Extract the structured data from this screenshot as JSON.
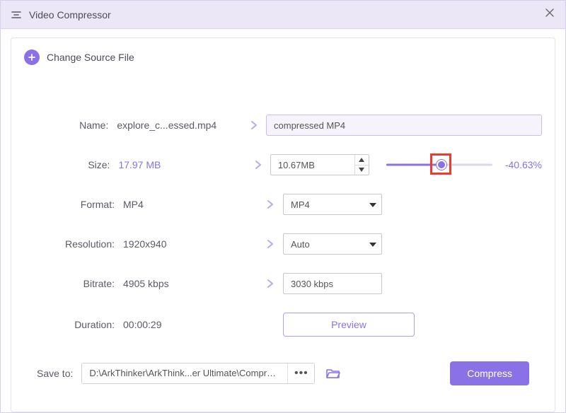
{
  "window": {
    "title": "Video Compressor"
  },
  "change_source": {
    "label": "Change Source File"
  },
  "fields": {
    "name": {
      "label": "Name:",
      "current": "explore_c...essed.mp4",
      "input": "compressed MP4"
    },
    "size": {
      "label": "Size:",
      "current": "17.97 MB",
      "input": "10.67MB",
      "delta": "-40.63%"
    },
    "format": {
      "label": "Format:",
      "current": "MP4",
      "input": "MP4"
    },
    "resolution": {
      "label": "Resolution:",
      "current": "1920x940",
      "input": "Auto"
    },
    "bitrate": {
      "label": "Bitrate:",
      "current": "4905 kbps",
      "input": "3030 kbps"
    },
    "duration": {
      "label": "Duration:",
      "current": "00:00:29"
    }
  },
  "preview": {
    "label": "Preview"
  },
  "footer": {
    "save_label": "Save to:",
    "path": "D:\\ArkThinker\\ArkThink...er Ultimate\\Compressed",
    "compress_label": "Compress"
  }
}
